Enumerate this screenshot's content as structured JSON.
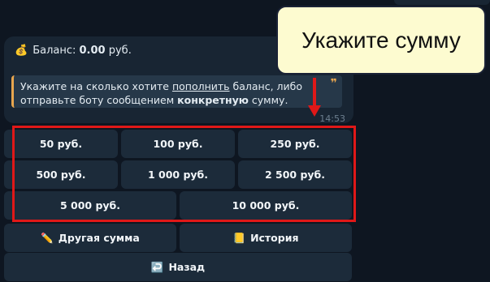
{
  "message": {
    "balance_icon": "money-bag-icon",
    "balance_label": "Баланс:",
    "balance_value": "0.00",
    "balance_currency": "руб.",
    "quote_part1": "Укажите на сколько хотите ",
    "quote_link": "пополнить",
    "quote_part2": " баланс, либо",
    "quote_part3": "отправьте боту сообщением ",
    "quote_bold": "конкретную",
    "quote_part4": " сумму.",
    "time": "14:53"
  },
  "keyboard": {
    "row1": [
      "50 руб.",
      "100 руб.",
      "250 руб."
    ],
    "row2": [
      "500 руб.",
      "1 000 руб.",
      "2 500 руб."
    ],
    "row3": [
      "5 000 руб.",
      "10 000 руб."
    ],
    "other_amount_icon": "pencil-icon",
    "other_amount": "Другая сумма",
    "history_icon": "notepad-icon",
    "history": "История",
    "back_icon": "return-arrow-icon",
    "back": "Назад"
  },
  "annotation": {
    "callout_text": "Укажите сумму",
    "accent_color": "#e01818"
  }
}
